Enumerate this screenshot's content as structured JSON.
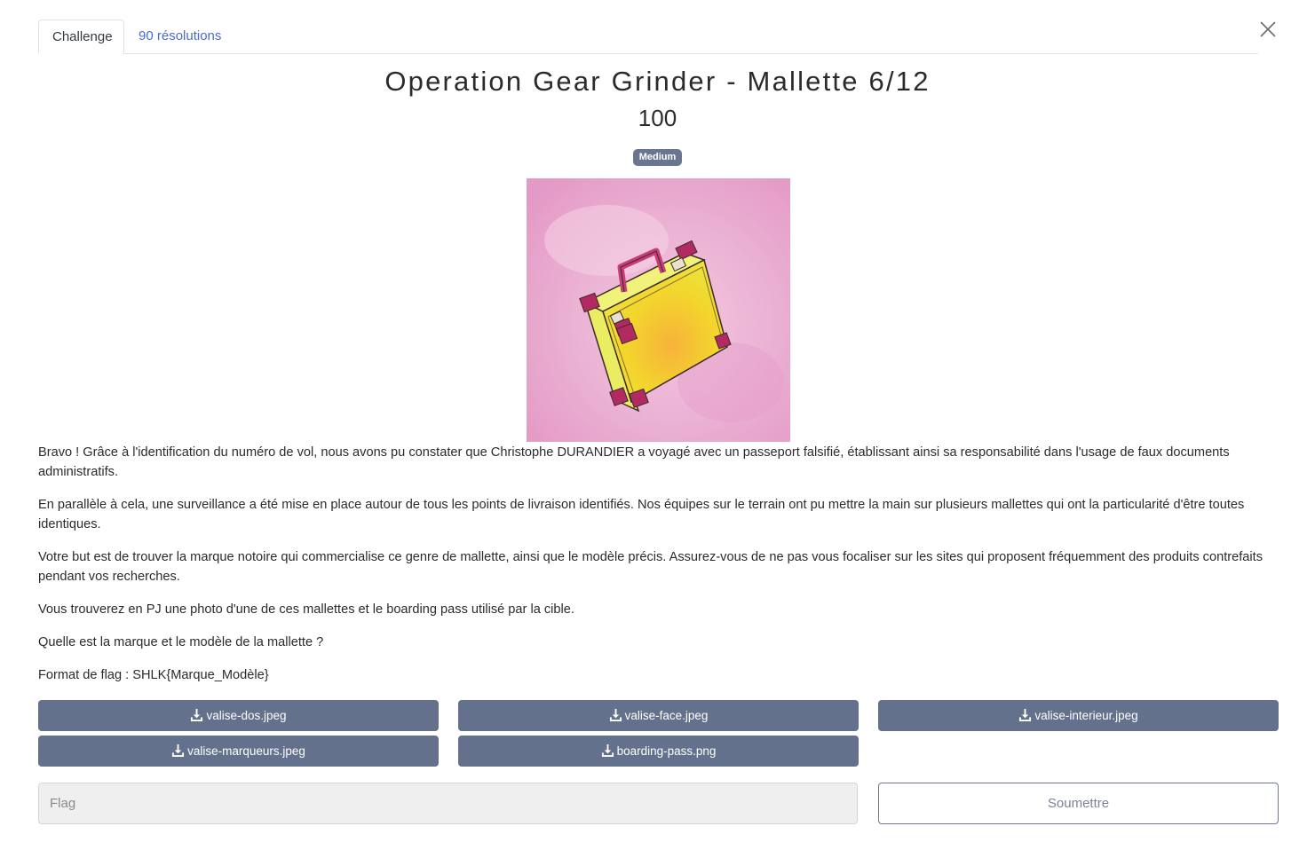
{
  "tabs": {
    "challenge": "Challenge",
    "solves": "90 résolutions"
  },
  "challenge": {
    "title": "Operation Gear Grinder - Mallette 6/12",
    "value": "100",
    "difficulty": "Medium"
  },
  "description": [
    "Bravo ! Grâce à l'identification du numéro de vol, nous avons pu constater que Christophe DURANDIER a voyagé avec un passeport falsifié, établissant ainsi sa responsabilité dans l'usage de faux documents administratifs.",
    "En parallèle à cela, une surveillance a été mise en place autour de tous les points de livraison identifiés. Nos équipes sur le terrain ont pu mettre la main sur plusieurs mallettes qui ont la particularité d'être toutes identiques.",
    "Votre but est de trouver la marque notoire qui commercialise ce genre de mallette, ainsi que le modèle précis. Assurez-vous de ne pas vous focaliser sur les sites qui proposent fréquemment des produits contrefaits pendant vos recherches.",
    "Vous trouverez en PJ une photo d'une de ces mallettes et le boarding pass utilisé par la cible.",
    "Quelle est la marque et le modèle de la mallette ?",
    "Format de flag : SHLK{Marque_Modèle}"
  ],
  "files": [
    "valise-dos.jpeg",
    "valise-face.jpeg",
    "valise-interieur.jpeg",
    "valise-marqueurs.jpeg",
    "boarding-pass.png"
  ],
  "form": {
    "flag_placeholder": "Flag",
    "flag_value": "",
    "submit_label": "Soumettre"
  },
  "colors": {
    "button_bg": "#64718c",
    "badge_bg": "#6a7590",
    "link": "#4b6bd6",
    "image_bg": "#ecb6d6",
    "suitcase": "#f2dc2c"
  },
  "icons": {
    "close": "close-icon",
    "download": "download-icon"
  }
}
